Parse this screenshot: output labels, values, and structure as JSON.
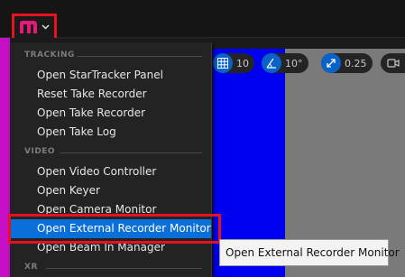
{
  "menu": {
    "sections": [
      {
        "heading": "TRACKING",
        "items": [
          {
            "label": "Open StarTracker Panel"
          },
          {
            "label": "Reset Take Recorder"
          },
          {
            "label": "Open Take Recorder"
          },
          {
            "label": "Open Take Log"
          }
        ]
      },
      {
        "heading": "VIDEO",
        "items": [
          {
            "label": "Open Video Controller"
          },
          {
            "label": "Open Keyer"
          },
          {
            "label": "Open Camera Monitor"
          },
          {
            "label": "Open External Recorder Monitor",
            "highlighted": true
          },
          {
            "label": "Open Beam In Manager"
          }
        ]
      },
      {
        "heading": "XR",
        "items": []
      }
    ]
  },
  "tooltip": {
    "text": "Open External Recorder Monitor"
  },
  "viewport_toolbar": {
    "grid_value": "10",
    "angle_value": "10°",
    "scale_value": "0.25"
  },
  "icons": {
    "logo": "m-logo-icon",
    "chevron": "chevron-down-icon",
    "grid": "grid-snap-icon",
    "angle": "angle-snap-icon",
    "scale": "scale-snap-icon",
    "camera": "camera-speed-icon"
  },
  "colors": {
    "logo_pink": "#e4197a",
    "highlight": "#0a6fd8",
    "annotation_red": "#e8121e",
    "toolbar_blue": "#0a61c7",
    "viewport_blue": "#0000f0",
    "magenta": "#c80fc8"
  }
}
